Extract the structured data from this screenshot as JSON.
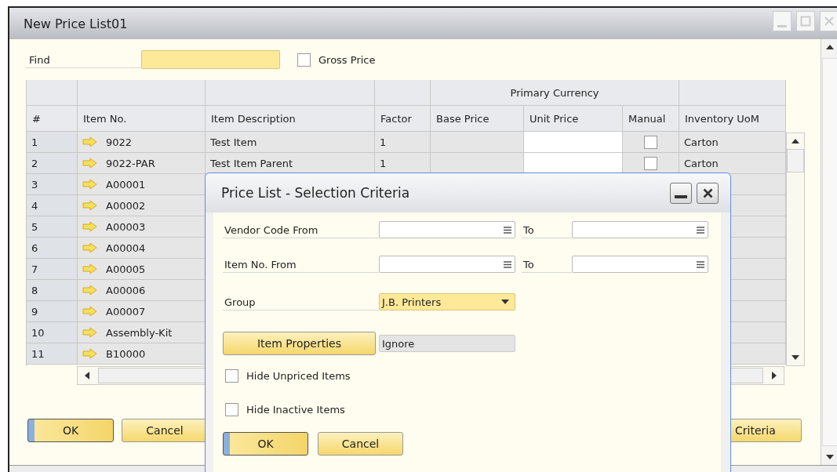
{
  "window": {
    "title": "New Price List01"
  },
  "find": {
    "label": "Find"
  },
  "gross_price": {
    "label": "Gross Price",
    "checked": false
  },
  "table": {
    "group_header": "Primary Currency",
    "columns": [
      "#",
      "Item No.",
      "Item Description",
      "Factor",
      "Base Price",
      "Unit Price",
      "Manual",
      "Inventory UoM"
    ],
    "rows": [
      {
        "number": "1",
        "item_no": "9022",
        "description": "Test Item",
        "factor": "1",
        "manual_checked": false,
        "uom": "Carton"
      },
      {
        "number": "2",
        "item_no": "9022-PAR",
        "description": "Test Item Parent",
        "factor": "1",
        "manual_checked": false,
        "uom": "Carton"
      },
      {
        "number": "3",
        "item_no": "A00001"
      },
      {
        "number": "4",
        "item_no": "A00002"
      },
      {
        "number": "5",
        "item_no": "A00003"
      },
      {
        "number": "6",
        "item_no": "A00004"
      },
      {
        "number": "7",
        "item_no": "A00005"
      },
      {
        "number": "8",
        "item_no": "A00006"
      },
      {
        "number": "9",
        "item_no": "A00007"
      },
      {
        "number": "10",
        "item_no": "Assembly-Kit"
      },
      {
        "number": "11",
        "item_no": "B10000"
      }
    ]
  },
  "buttons": [
    {
      "label": "OK",
      "default": true
    },
    {
      "label": "Cancel",
      "default": false
    }
  ],
  "criteria_button": {
    "label": "Criteria"
  },
  "dialog": {
    "title": "Price List - Selection Criteria",
    "ranges": [
      {
        "label": "Vendor Code From",
        "to_label": "To"
      },
      {
        "label": "Item No. From",
        "to_label": "To"
      }
    ],
    "group": {
      "label": "Group",
      "value": "J.B. Printers"
    },
    "item_properties": {
      "label": "Item Properties",
      "value": "Ignore"
    },
    "checkboxes": [
      {
        "label": "Hide Unpriced Items",
        "checked": false
      },
      {
        "label": "Hide Inactive Items",
        "checked": false
      }
    ],
    "buttons": [
      {
        "label": "OK",
        "default": true
      },
      {
        "label": "Cancel",
        "default": false
      }
    ]
  }
}
